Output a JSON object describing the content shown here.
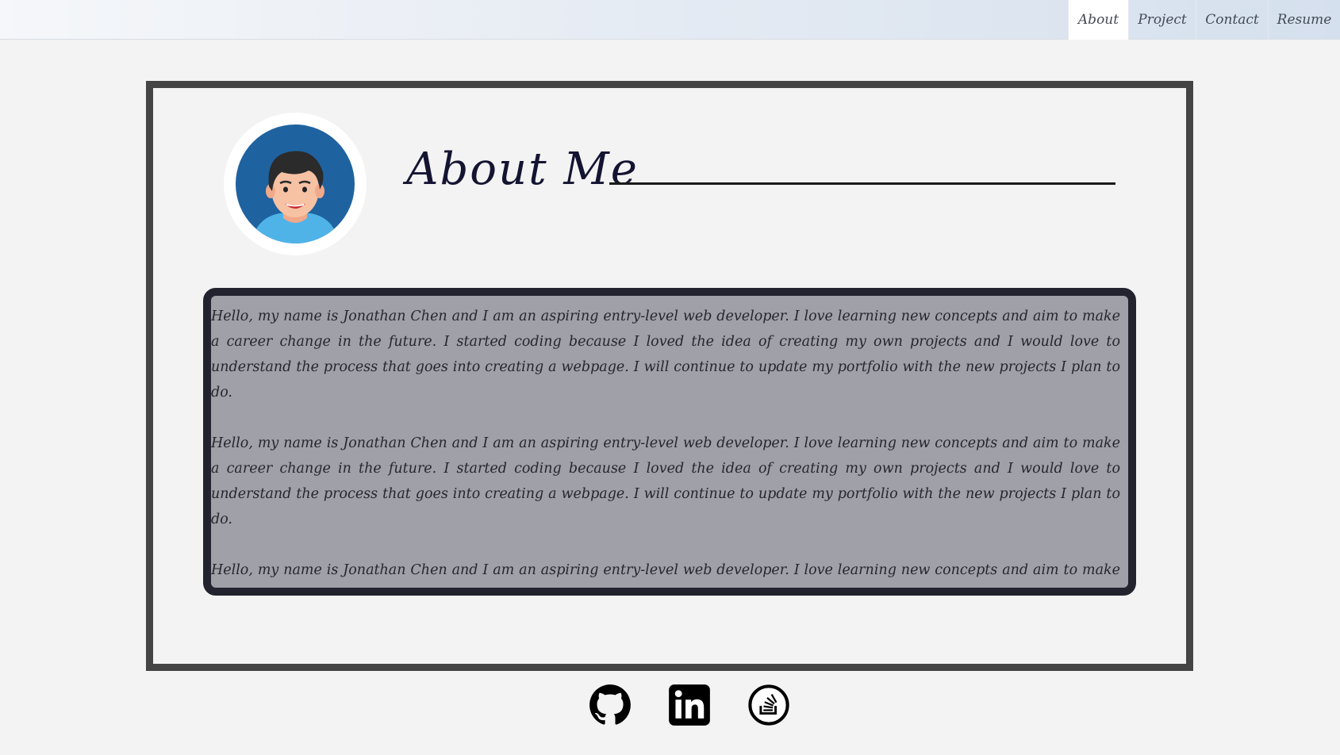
{
  "nav": {
    "tabs": [
      {
        "label": "About",
        "active": true
      },
      {
        "label": "Project",
        "active": false
      },
      {
        "label": "Contact",
        "active": false
      },
      {
        "label": "Resume",
        "active": false
      }
    ]
  },
  "about": {
    "title": "About Me",
    "paragraphs": [
      "Hello, my name is Jonathan Chen and I am an aspiring entry-level web developer. I love learning new concepts and aim to make a career change in the future. I started coding because I loved the idea of creating my own projects and I would love to understand the process that goes into creating a webpage. I will continue to update my portfolio with the new projects I plan to do.",
      "Hello, my name is Jonathan Chen and I am an aspiring entry-level web developer. I love learning new concepts and aim to make a career change in the future. I started coding because I loved the idea of creating my own projects and I would love to understand the process that goes into creating a webpage. I will continue to update my portfolio with the new projects I plan to do.",
      "Hello, my name is Jonathan Chen and I am an aspiring entry-level web developer. I love learning new concepts and aim to make a career change in the future. I started coding because I loved the idea of creating my own projects and I would love to understand the process that goes into creating a webpage. I will continue to update my portfolio with the new projects I plan to do."
    ]
  },
  "social": {
    "icons": [
      "github-icon",
      "linkedin-icon",
      "stackoverflow-icon"
    ]
  },
  "colors": {
    "card_border": "#444444",
    "bio_bg": "#a0a0a8",
    "bio_border": "#232330",
    "avatar_bg": "#1f62a0"
  }
}
